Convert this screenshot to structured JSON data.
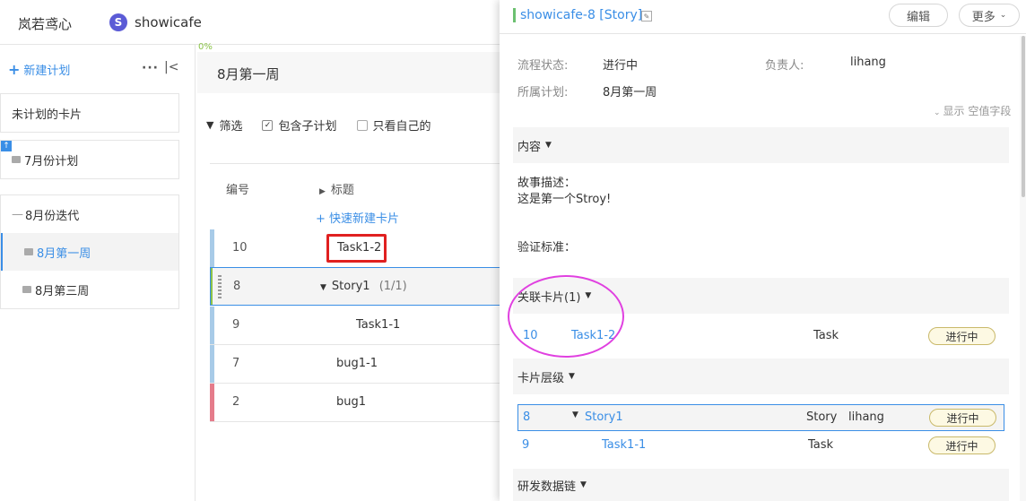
{
  "header": {
    "org_name": "岚若鸢心",
    "project_avatar": "S",
    "project_name": "showicafe"
  },
  "sidebar": {
    "new_plan_label": "新建计划",
    "more_icon": "···",
    "collapse_icon": "|<",
    "unplanned_label": "未计划的卡片",
    "plan_july": "7月份计划",
    "iteration_aug": "8月份迭代",
    "week1": "8月第一周",
    "week3": "8月第三周"
  },
  "main": {
    "progress": "0%",
    "iteration_title": "8月第一周",
    "filter_label": "筛选",
    "include_sub_label": "包含子计划",
    "only_mine_label": "只看自己的",
    "col_num": "编号",
    "col_title": "标题",
    "quick_new": "+ 快速新建卡片",
    "rows": [
      {
        "num": "10",
        "title": "Task1-2",
        "bar_color": "#a8cbe8"
      },
      {
        "num": "8",
        "title": "Story1",
        "extra": "(1/1)",
        "bar_color": "#8bc34a"
      },
      {
        "num": "9",
        "title": "Task1-1",
        "bar_color": "#a8cbe8"
      },
      {
        "num": "7",
        "title": "bug1-1",
        "bar_color": "#a8cbe8"
      },
      {
        "num": "2",
        "title": "bug1",
        "bar_color": "#e57c8b"
      }
    ]
  },
  "panel": {
    "title": "showicafe-8 [Story]",
    "edit_button": "编辑",
    "more_button": "更多",
    "status_label": "流程状态:",
    "status_value": "进行中",
    "owner_label": "负责人:",
    "owner_value": "lihang",
    "plan_label": "所属计划:",
    "plan_value": "8月第一周",
    "show_empty": "显示 空值字段",
    "content_section": "内容",
    "story_desc_label": "故事描述：",
    "story_desc_value": "这是第一个Stroy!",
    "acceptance_label": "验证标准：",
    "related_section": "关联卡片(1)",
    "related": {
      "num": "10",
      "title": "Task1-2",
      "type": "Task",
      "status": "进行中"
    },
    "hierarchy_section": "卡片层级",
    "hierarchy": [
      {
        "num": "8",
        "title": "Story1",
        "type": "Story",
        "owner": "lihang",
        "status": "进行中"
      },
      {
        "num": "9",
        "title": "Task1-1",
        "type": "Task",
        "owner": "",
        "status": "进行中"
      }
    ],
    "devchain_section": "研发数据链"
  }
}
